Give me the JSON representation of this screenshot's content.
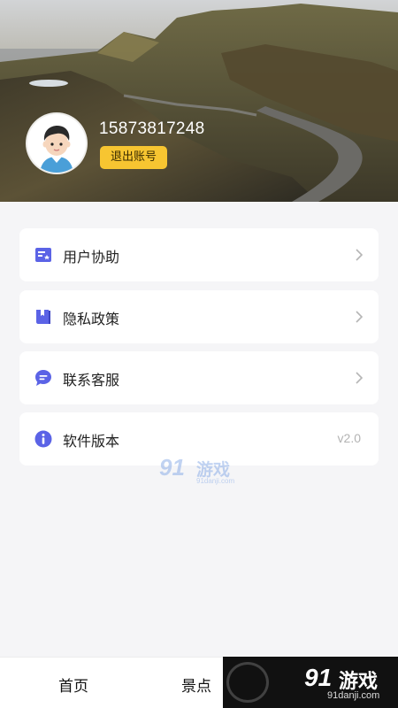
{
  "profile": {
    "phone": "15873817248",
    "logout_label": "退出账号"
  },
  "menu": [
    {
      "label": "用户协助",
      "icon": "agreement-icon"
    },
    {
      "label": "隐私政策",
      "icon": "book-icon"
    },
    {
      "label": "联系客服",
      "icon": "chat-icon"
    },
    {
      "label": "软件版本",
      "icon": "info-icon",
      "value": "v2.0"
    }
  ],
  "tabs": [
    {
      "label": "首页"
    },
    {
      "label": "景点"
    }
  ],
  "watermark": {
    "brand_num": "91",
    "brand_cn": "游戏",
    "url": "91danji.com"
  },
  "colors": {
    "accent": "#5b63e6",
    "logout_bg": "#f7c531",
    "page_bg": "#f5f5f7"
  }
}
